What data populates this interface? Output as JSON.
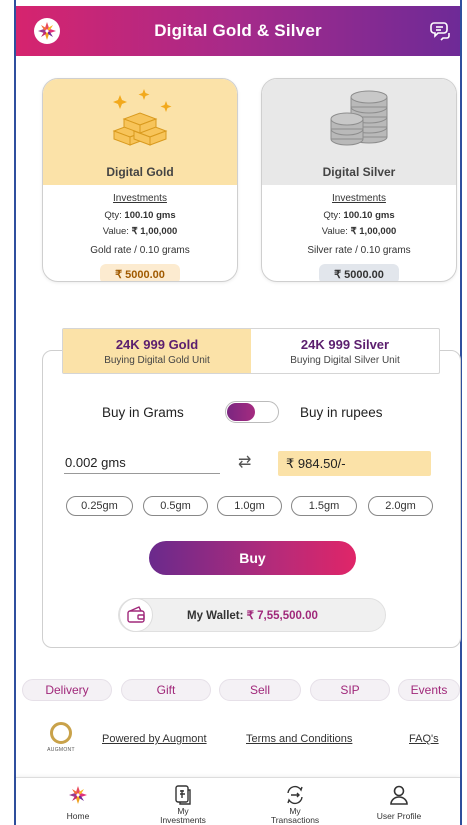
{
  "header": {
    "title": "Digital Gold & Silver"
  },
  "cards": {
    "gold": {
      "name": "Digital Gold",
      "investments_label": "Investments",
      "qty_label": "Qty: ",
      "qty_value": "100.10 gms",
      "value_label": "Value: ",
      "value_amount": "₹ 1,00,000",
      "rate_label": "Gold rate / 0.10 grams",
      "price": "₹ 5000.00"
    },
    "silver": {
      "name": "Digital Silver",
      "investments_label": "Investments",
      "qty_label": "Qty: ",
      "qty_value": "100.10 gms",
      "value_label": "Value: ",
      "value_amount": "₹ 1,00,000",
      "rate_label": "Silver rate / 0.10 grams",
      "price": "₹ 5000.00"
    }
  },
  "tabs": [
    {
      "title": "24K 999 Gold",
      "subtitle": "Buying Digital Gold Unit",
      "active": true
    },
    {
      "title": "24K 999 Silver",
      "subtitle": "Buying Digital Silver Unit",
      "active": false
    }
  ],
  "toggle": {
    "left_label": "Buy in Grams",
    "right_label": "Buy in rupees"
  },
  "quantity_input": {
    "value": "0.002 gms"
  },
  "amount_value": "₹ 984.50/-",
  "chips": [
    "0.25gm",
    "0.5gm",
    "1.0gm",
    "1.5gm",
    "2.0gm"
  ],
  "buy_label": "Buy",
  "wallet": {
    "label": "My Wallet: ",
    "amount": "₹ 7,55,500.00"
  },
  "actions": [
    "Delivery",
    "Gift",
    "Sell",
    "SIP",
    "Events"
  ],
  "footer": {
    "brand": "AUGMONT",
    "powered_by": "Powered by Augmont",
    "terms": "Terms and Conditions",
    "faq": "FAQ's"
  },
  "nav": [
    {
      "label": "Home",
      "icon": "home-star-icon"
    },
    {
      "label": "My Investments",
      "icon": "investments-icon"
    },
    {
      "label": "My Transactions",
      "icon": "transactions-icon"
    },
    {
      "label": "User Profile",
      "icon": "user-icon"
    }
  ],
  "colors": {
    "brand_pink": "#d6246e",
    "brand_purple": "#6e2a97",
    "gold_bg": "#fbe2a8"
  }
}
